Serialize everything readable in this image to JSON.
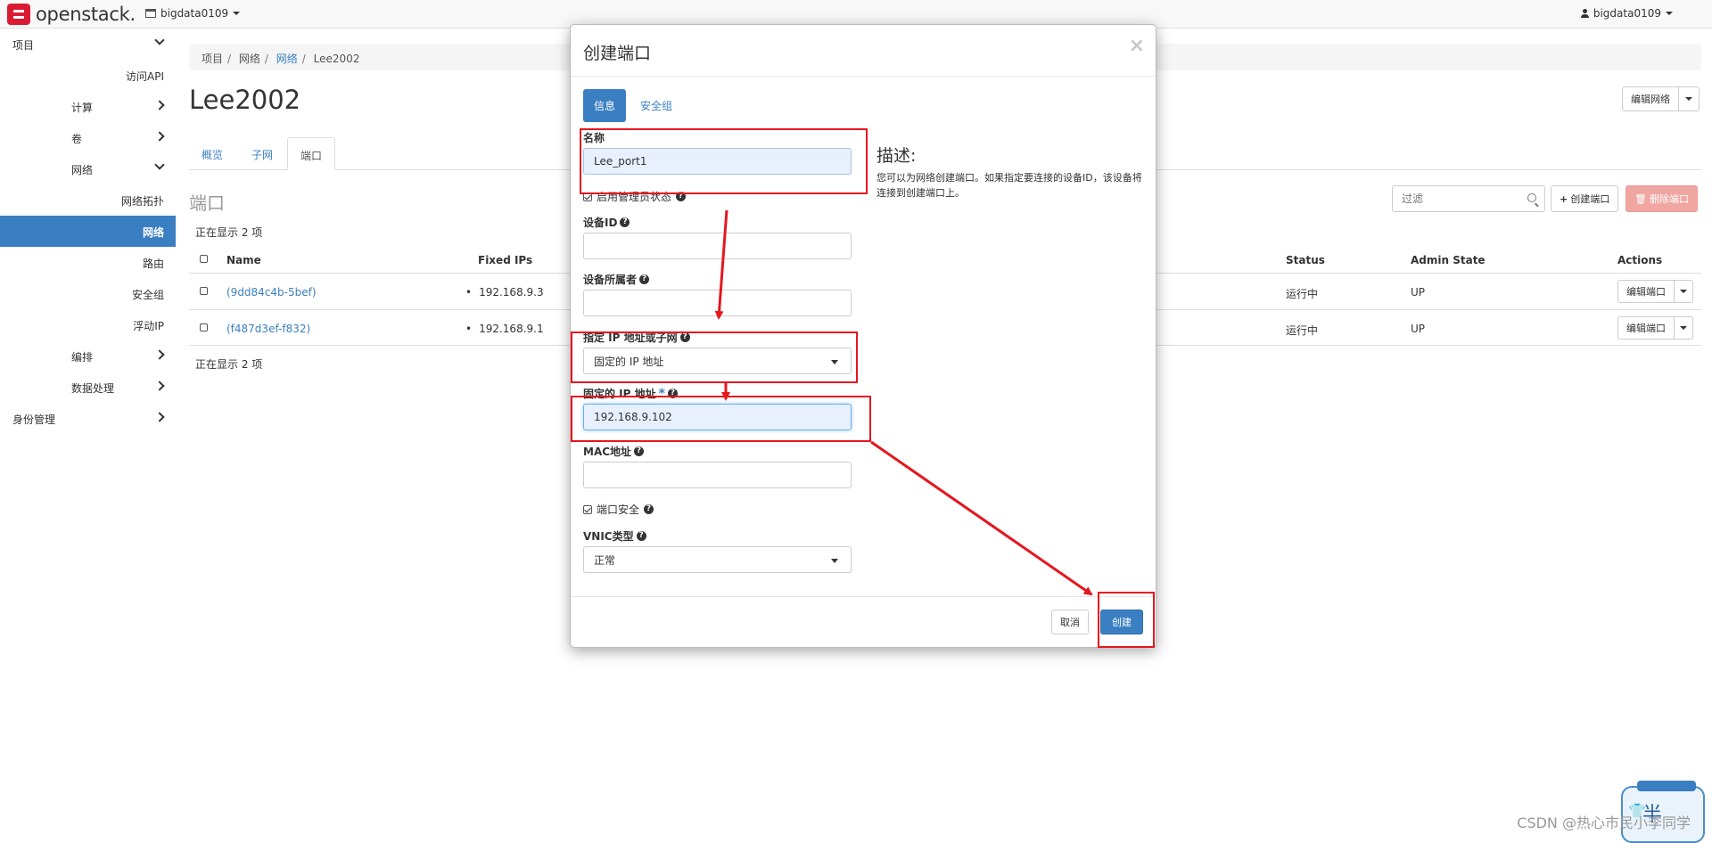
{
  "navbar": {
    "brand": "openstack.",
    "project": "bigdata0109",
    "user": "bigdata0109"
  },
  "sidebar": {
    "items": [
      {
        "label": "项目",
        "level": 0,
        "chevron": "down"
      },
      {
        "label": "访问API",
        "level": 2
      },
      {
        "label": "计算",
        "level": 1,
        "chevron": "right"
      },
      {
        "label": "卷",
        "level": 1,
        "chevron": "right"
      },
      {
        "label": "网络",
        "level": 1,
        "chevron": "down"
      },
      {
        "label": "网络拓扑",
        "level": 2
      },
      {
        "label": "网络",
        "level": 2,
        "active": true
      },
      {
        "label": "路由",
        "level": 2
      },
      {
        "label": "安全组",
        "level": 2
      },
      {
        "label": "浮动IP",
        "level": 2
      },
      {
        "label": "编排",
        "level": 1,
        "chevron": "right"
      },
      {
        "label": "数据处理",
        "level": 1,
        "chevron": "right"
      },
      {
        "label": "身份管理",
        "level": 0,
        "chevron": "right"
      }
    ]
  },
  "breadcrumb": {
    "items": [
      "项目",
      "网络",
      "网络",
      "Lee2002"
    ]
  },
  "page": {
    "title": "Lee2002",
    "edit_network_label": "编辑网络",
    "tabs": [
      "概览",
      "子网",
      "端口"
    ],
    "section_title": "端口",
    "filter_placeholder": "过滤",
    "create_port_label": "创建端口",
    "delete_port_label": "删除端口",
    "count_text_top": "正在显示 2 项",
    "count_text_bottom": "正在显示 2 项"
  },
  "table": {
    "headers": {
      "name": "Name",
      "fixed_ips": "Fixed IPs",
      "status": "Status",
      "admin_state": "Admin State",
      "actions": "Actions"
    },
    "rows": [
      {
        "name": "(9dd84c4b-5bef)",
        "fixed_ip": "192.168.9.3",
        "status": "运行中",
        "admin_state": "UP",
        "action": "编辑端口"
      },
      {
        "name": "(f487d3ef-f832)",
        "fixed_ip": "192.168.9.1",
        "status": "运行中",
        "admin_state": "UP",
        "action": "编辑端口"
      }
    ]
  },
  "modal": {
    "title": "创建端口",
    "close": "×",
    "tabs": [
      "信息",
      "安全组"
    ],
    "name_label": "名称",
    "name_value": "Lee_port1",
    "admin_state_label": "启用管理员状态",
    "device_id_label": "设备ID",
    "device_id_value": "",
    "device_owner_label": "设备所属者",
    "device_owner_value": "",
    "ip_or_subnet_label": "指定 IP 地址或子网",
    "ip_or_subnet_value": "固定的 IP 地址",
    "fixed_ip_label": "固定的 IP 地址",
    "fixed_ip_required": "*",
    "fixed_ip_value": "192.168.9.102",
    "mac_label": "MAC地址",
    "mac_value": "",
    "port_security_label": "端口安全",
    "vnic_label": "VNIC类型",
    "vnic_value": "正常",
    "desc_title": "描述:",
    "desc_text": "您可以为网络创建端口。如果指定要连接的设备ID，该设备将连接到创建端口上。",
    "cancel_label": "取消",
    "create_label": "创建"
  },
  "overlay": {
    "watermark": "CSDN @热心市民小李同学",
    "widget_text": "半",
    "annotation_color": "#e5171e"
  }
}
